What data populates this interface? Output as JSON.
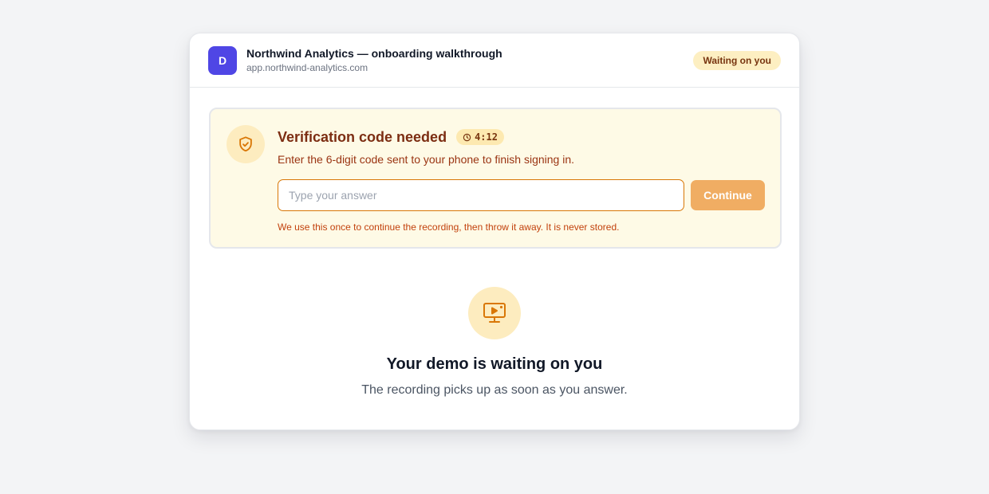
{
  "header": {
    "avatar_letter": "D",
    "title": "Northwind Analytics — onboarding walkthrough",
    "url": "app.northwind-analytics.com",
    "status_badge": "Waiting on you"
  },
  "prompt": {
    "icon": "shield-check-icon",
    "title": "Verification code needed",
    "timer_icon": "clock-icon",
    "timer": "4:12",
    "description": "Enter the 6-digit code sent to your phone to finish signing in.",
    "input_value": "",
    "input_placeholder": "Type your answer",
    "button_label": "Continue",
    "note": "We use this once to continue the recording, then throw it away. It is never stored."
  },
  "waiting": {
    "icon": "screen-play-icon",
    "title": "Your demo is waiting on you",
    "subtitle": "The recording picks up as soon as you answer."
  },
  "colors": {
    "brand": "#4f46e5",
    "accent": "#d97706",
    "button": "#f0ad63",
    "prompt_bg": "#fefae6"
  }
}
